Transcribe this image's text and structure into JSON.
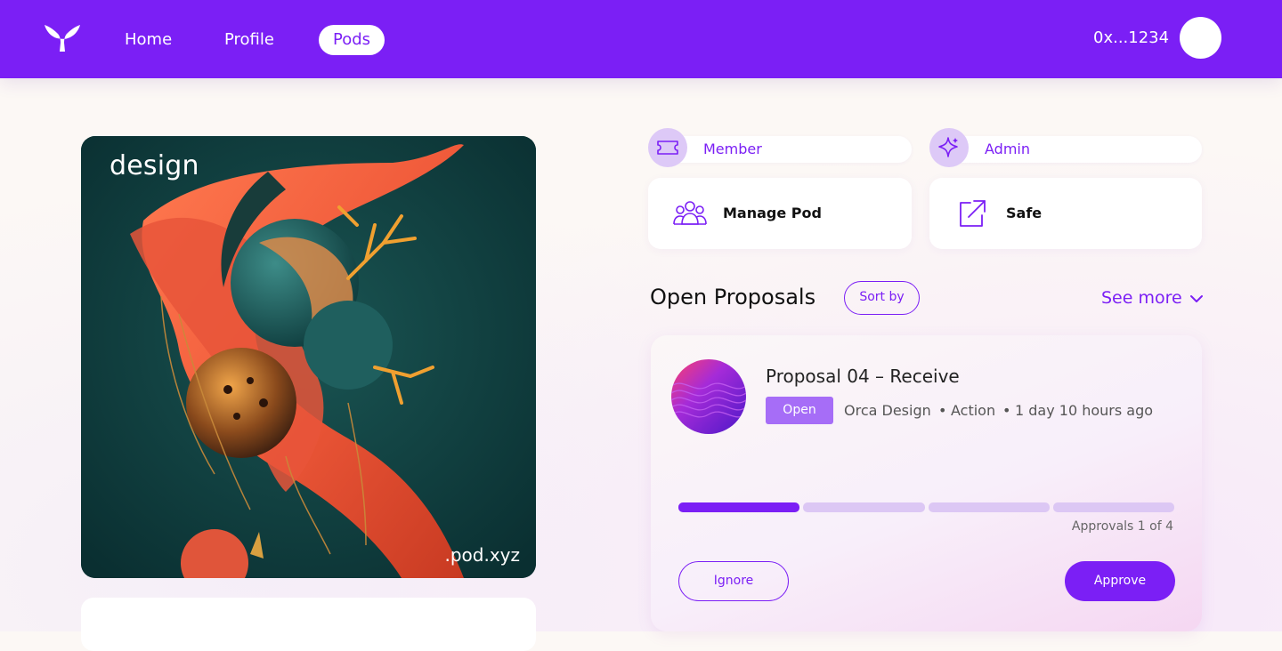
{
  "nav": {
    "items": [
      {
        "label": "Home"
      },
      {
        "label": "Profile"
      },
      {
        "label": "Pods",
        "active": true
      }
    ],
    "wallet": "0x...1234",
    "brand_color": "#7b1ff5"
  },
  "artwork": {
    "title": "design",
    "domain": ".pod.xyz"
  },
  "roles": [
    {
      "label": "Member",
      "icon": "ticket-icon"
    },
    {
      "label": "Admin",
      "icon": "sparkle-icon"
    }
  ],
  "actions": [
    {
      "label": "Manage Pod",
      "icon": "users-icon"
    },
    {
      "label": "Safe",
      "icon": "external-link-icon"
    }
  ],
  "proposals_section": {
    "title": "Open Proposals",
    "sort_label": "Sort by",
    "see_more_label": "See more"
  },
  "proposal": {
    "title": "Proposal 04 – Receive",
    "status": "Open",
    "org": "Orca Design",
    "separator": "•",
    "type": "Action",
    "time": "1 day 10 hours ago",
    "approvals_current": 1,
    "approvals_total": 4,
    "approvals_label": "Approvals 1 of 4",
    "ignore_label": "Ignore",
    "approve_label": "Approve"
  }
}
